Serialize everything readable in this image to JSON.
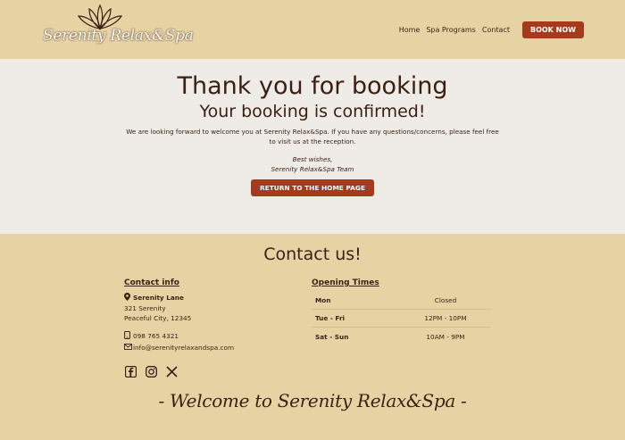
{
  "header": {
    "logo_text": "Serenity Relax&Spa",
    "nav": [
      "Home",
      "Spa Programs",
      "Contact"
    ],
    "book_label": "BOOK NOW"
  },
  "confirmation": {
    "title": "Thank you for booking",
    "subtitle": "Your booking is confirmed!",
    "message": "We are looking forward to welcome you at Serenity Relax&Spa. If you have any questions/concerns, please feel free to visit us at the reception.",
    "sign_line1": "Best wishes,",
    "sign_line2": "Serenity Relax&Spa Team",
    "return_label": "RETURN TO THE HOME PAGE"
  },
  "contact": {
    "title": "Contact us!",
    "info_heading": "Contact info",
    "address_name": "Serenity Lane",
    "address_line1": "321 Serenity",
    "address_line2": "Peaceful City, 12345",
    "phone": "098 765 4321",
    "email": "info@serenityrelaxandspa.com",
    "socials": [
      "facebook-icon",
      "instagram-icon",
      "x-icon"
    ],
    "times_heading": "Opening Times",
    "times": [
      {
        "day": "Mon",
        "hours": "Closed"
      },
      {
        "day": "Tue - Fri",
        "hours": "12PM - 10PM"
      },
      {
        "day": "Sat - Sun",
        "hours": "10AM - 9PM"
      }
    ],
    "welcome": "- Welcome to Serenity Relax&Spa -"
  },
  "colors": {
    "beige": "#e6d3a3",
    "light": "#efebe6",
    "accent": "#a53a1c",
    "text": "#3a1f12"
  }
}
